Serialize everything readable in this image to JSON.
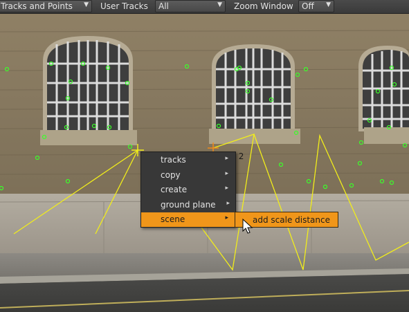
{
  "toolbar": {
    "view_dropdown": "Tracks and Points",
    "user_tracks_label": "User Tracks",
    "user_tracks_value": "All",
    "zoom_window_label": "Zoom Window",
    "zoom_window_value": "Off"
  },
  "context_menu": {
    "items": [
      {
        "label": "tracks"
      },
      {
        "label": "copy"
      },
      {
        "label": "create"
      },
      {
        "label": "ground plane"
      },
      {
        "label": "scene"
      }
    ],
    "submenu": {
      "label": "add scale distance"
    }
  },
  "annotation": "r 2",
  "colors": {
    "highlight": "#f0961a",
    "track_line": "#f2ee1a",
    "track_point": "#3bff2a"
  },
  "icons": [
    "submenu-arrow-icon",
    "dropdown-arrow-icon",
    "mouse-cursor-icon"
  ]
}
